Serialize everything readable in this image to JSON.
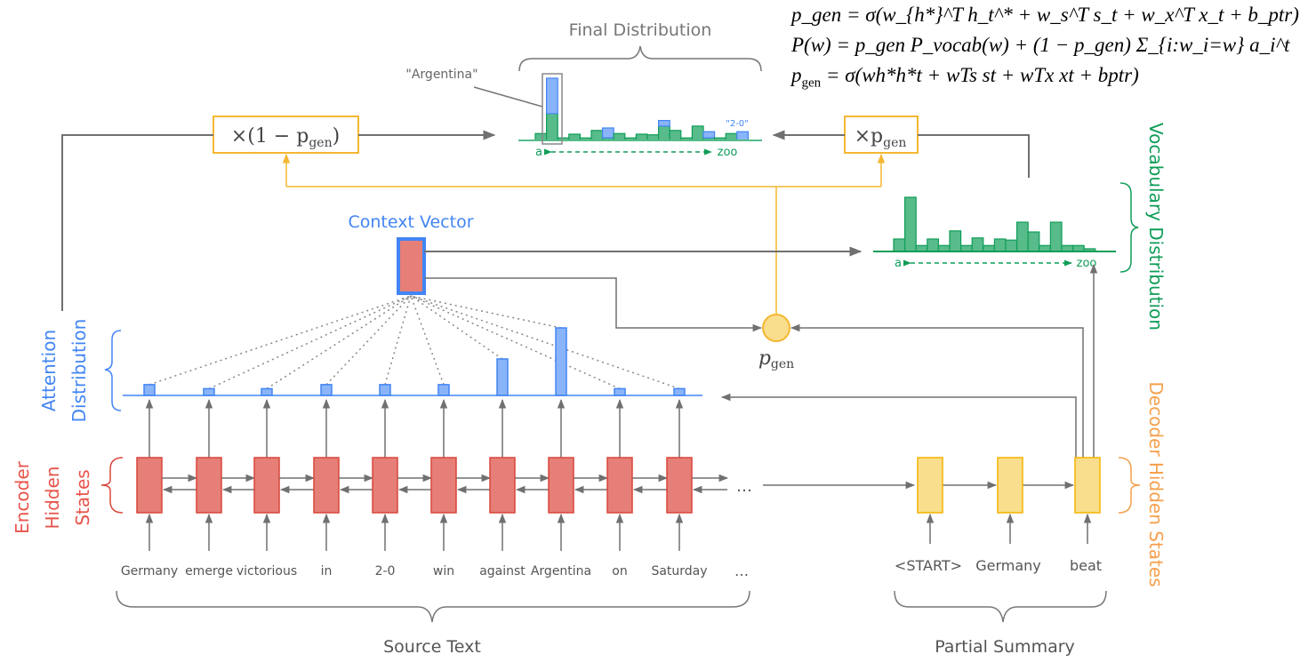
{
  "formulas": {
    "pgen_lhs": "p",
    "pgen_lhs_sub": "gen",
    "pgen_rhs": "= σ(w",
    "pgen_rest": "h*h*t + wTs st + wTx xt + bptr)",
    "pgen_text": "p_gen = σ(w_{h*}^T h_t^* + w_s^T s_t + w_x^T x_t + b_ptr)",
    "pw_text": "P(w) = p_gen P_vocab(w) + (1 − p_gen) Σ_{i:w_i=w} a_i^t"
  },
  "labels": {
    "final_distribution": "Final Distribution",
    "argentina_callout": "\"Argentina\"",
    "two_zero_callout": "\"2-0\"",
    "one_minus_pgen": "×(1 − p",
    "times_pgen": "×p",
    "gen": "gen",
    "pgen": "p",
    "context_vector": "Context Vector",
    "vocabulary_distribution": "Vocabulary Distribution",
    "attention_distribution": [
      "Attention",
      "Distribution"
    ],
    "encoder_hidden_states": [
      "Encoder",
      "Hidden",
      "States"
    ],
    "decoder_hidden_states": "Decoder Hidden States",
    "source_text": "Source Text",
    "partial_summary": "Partial Summary",
    "axis_start": "a",
    "axis_end": "zoo",
    "ellipsis": "…"
  },
  "source_words": [
    "Germany",
    "emerge",
    "victorious",
    "in",
    "2-0",
    "win",
    "against",
    "Argentina",
    "on",
    "Saturday"
  ],
  "summary_words": [
    "<START>",
    "Germany",
    "beat"
  ],
  "colors": {
    "encoder": "#E57F77",
    "encoder_stroke": "#D9463B",
    "decoder": "#F9DE8E",
    "decoder_stroke": "#F4B400",
    "attention": "#8AB4F8",
    "attention_stroke": "#4285F4",
    "vocab": "#57BB8A",
    "vocab_stroke": "#0F9D58",
    "arrow": "#707070",
    "gate": "#F5B731"
  },
  "chart_data": [
    {
      "type": "bar",
      "name": "attention distribution",
      "categories": [
        "Germany",
        "emerge",
        "victorious",
        "in",
        "2-0",
        "win",
        "against",
        "Argentina",
        "on",
        "Saturday"
      ],
      "values": [
        0.16,
        0.1,
        0.1,
        0.16,
        0.16,
        0.16,
        0.54,
        1.0,
        0.1,
        0.1
      ]
    },
    {
      "type": "bar",
      "name": "vocabulary distribution",
      "values": [
        0.23,
        1.0,
        0.11,
        0.23,
        0.11,
        0.38,
        0.11,
        0.25,
        0.11,
        0.23,
        0.21,
        0.54,
        0.36,
        0.11,
        0.54,
        0.11,
        0.11,
        0.05
      ]
    },
    {
      "type": "bar",
      "name": "final distribution",
      "stacked": true,
      "generate": [
        0.11,
        0.43,
        0.04,
        0.1,
        0.04,
        0.16,
        0.04,
        0.11,
        0.04,
        0.1,
        0.09,
        0.23,
        0.16,
        0.04,
        0.23,
        0.04,
        0.04,
        0.11,
        0.0
      ],
      "copy": [
        0,
        0.57,
        0,
        0,
        0,
        0,
        0.16,
        0,
        0,
        0,
        0,
        0.09,
        0,
        0,
        0,
        0.1,
        0,
        0,
        0.14
      ]
    }
  ]
}
